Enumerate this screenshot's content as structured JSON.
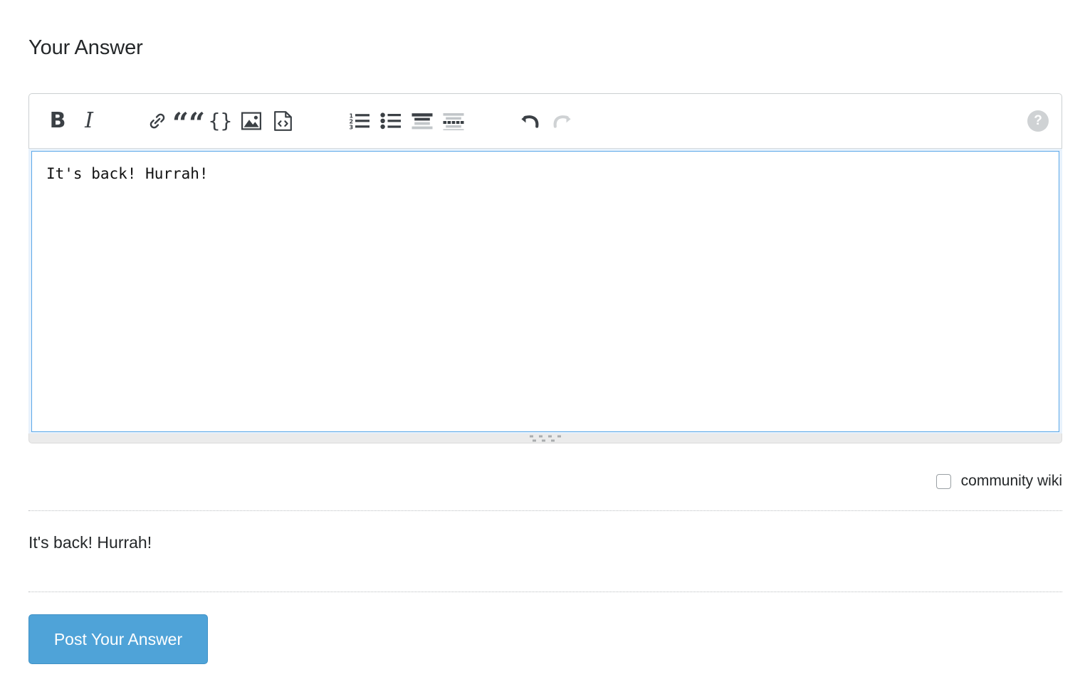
{
  "page": {
    "section_title": "Your Answer"
  },
  "toolbar": {
    "buttons": [
      {
        "name": "bold-icon",
        "label": "B",
        "title": "Bold",
        "state": "enabled"
      },
      {
        "name": "italic-icon",
        "label": "I",
        "title": "Italic",
        "state": "enabled"
      },
      {
        "name": "link-icon",
        "label": "",
        "title": "Hyperlink",
        "state": "enabled"
      },
      {
        "name": "blockquote-icon",
        "label": "““",
        "title": "Blockquote",
        "state": "enabled"
      },
      {
        "name": "code-block-icon",
        "label": "{}",
        "title": "Code Sample",
        "state": "enabled"
      },
      {
        "name": "image-icon",
        "label": "",
        "title": "Image",
        "state": "enabled"
      },
      {
        "name": "html-snippet-icon",
        "label": "",
        "title": "Code Snippet",
        "state": "enabled"
      },
      {
        "name": "numbered-list-icon",
        "label": "",
        "title": "Numbered List",
        "state": "enabled"
      },
      {
        "name": "bulleted-list-icon",
        "label": "",
        "title": "Bulleted List",
        "state": "enabled"
      },
      {
        "name": "heading-icon",
        "label": "",
        "title": "Heading",
        "state": "enabled"
      },
      {
        "name": "horizontal-rule-icon",
        "label": "",
        "title": "Horizontal Rule",
        "state": "enabled"
      },
      {
        "name": "undo-icon",
        "label": "",
        "title": "Undo",
        "state": "enabled"
      },
      {
        "name": "redo-icon",
        "label": "",
        "title": "Redo",
        "state": "disabled"
      }
    ],
    "help": {
      "name": "help-icon",
      "glyph": "?",
      "title": "Help"
    }
  },
  "editor": {
    "value": "It's back! Hurrah!",
    "placeholder": "",
    "focused": true,
    "resize_grip": "resize-grip"
  },
  "options": {
    "community_wiki_label": "community wiki",
    "community_wiki_checked": false
  },
  "preview": {
    "text": "It's back! Hurrah!"
  },
  "actions": {
    "post_label": "Post Your Answer"
  },
  "colors": {
    "accent_blue": "#4fa3d8",
    "focus_border": "#5aa7e8",
    "focus_glow": "#e8f2fc",
    "icon_dark": "#3b4045",
    "icon_disabled": "#cfd2d4",
    "text": "#242729"
  }
}
